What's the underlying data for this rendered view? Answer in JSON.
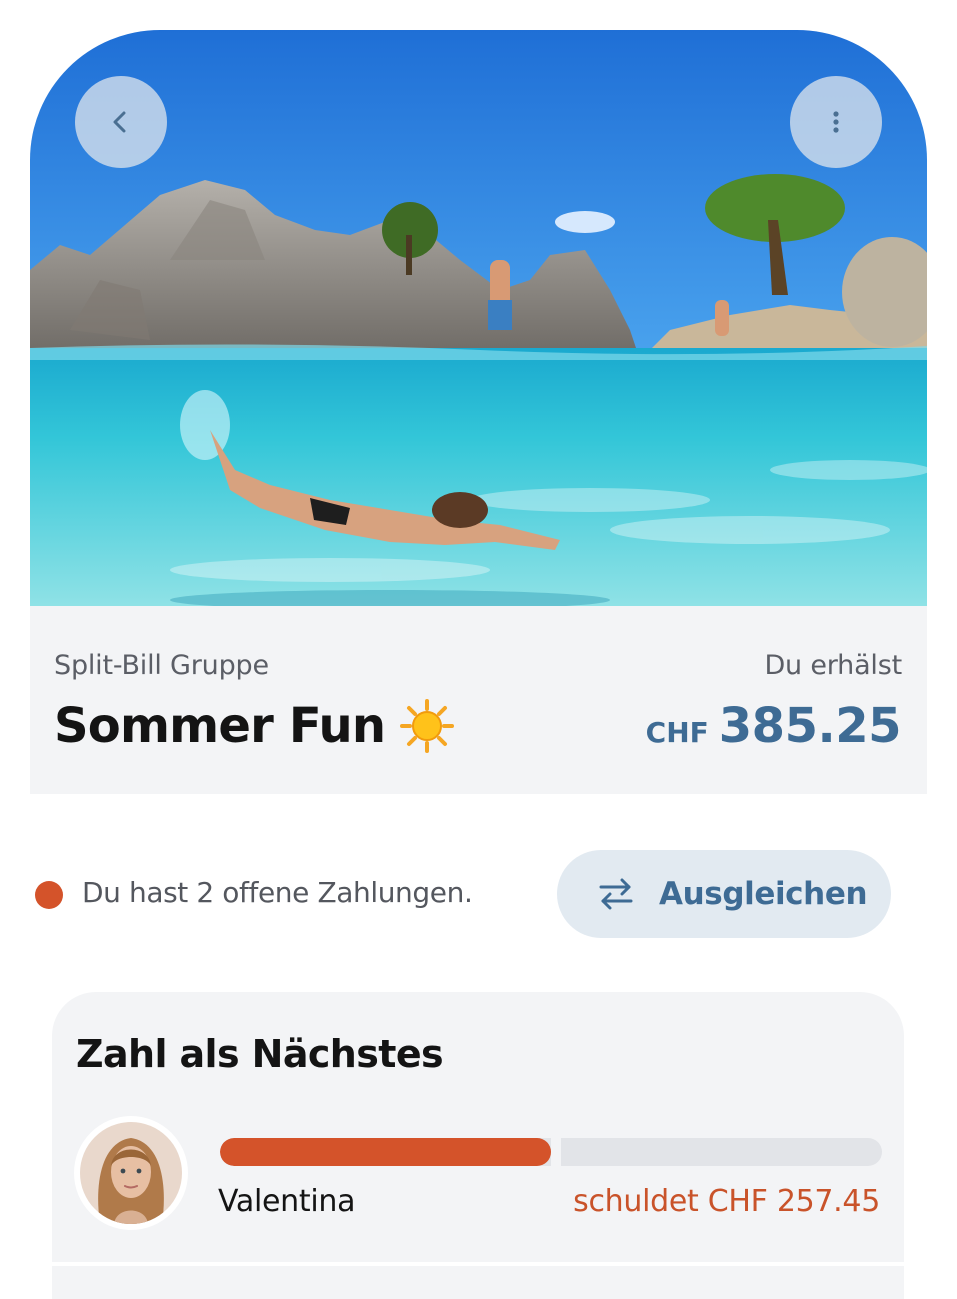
{
  "hero": {
    "image": "beach-snorkel-photo",
    "back_icon": "chevron-left-icon",
    "more_icon": "more-vertical-icon"
  },
  "group": {
    "label": "Split-Bill Gruppe",
    "title": "Sommer Fun",
    "emoji_icon": "sun-icon",
    "receive_label": "Du erhälst",
    "currency": "CHF",
    "amount": "385.25"
  },
  "status": {
    "text": "Du hast 2 offene Zahlungen.",
    "dot_color": "#d4532a"
  },
  "settle_button": {
    "label": "Ausgleichen",
    "icon": "swap-arrows-icon"
  },
  "next_payer": {
    "title": "Zahl als Nächstes",
    "member": {
      "name": "Valentina",
      "owes_text": "schuldet CHF 257.45",
      "progress_fraction": 0.5
    }
  },
  "colors": {
    "accent": "#3e6b94",
    "debt": "#d4532a",
    "card_bg": "#f3f4f6"
  }
}
